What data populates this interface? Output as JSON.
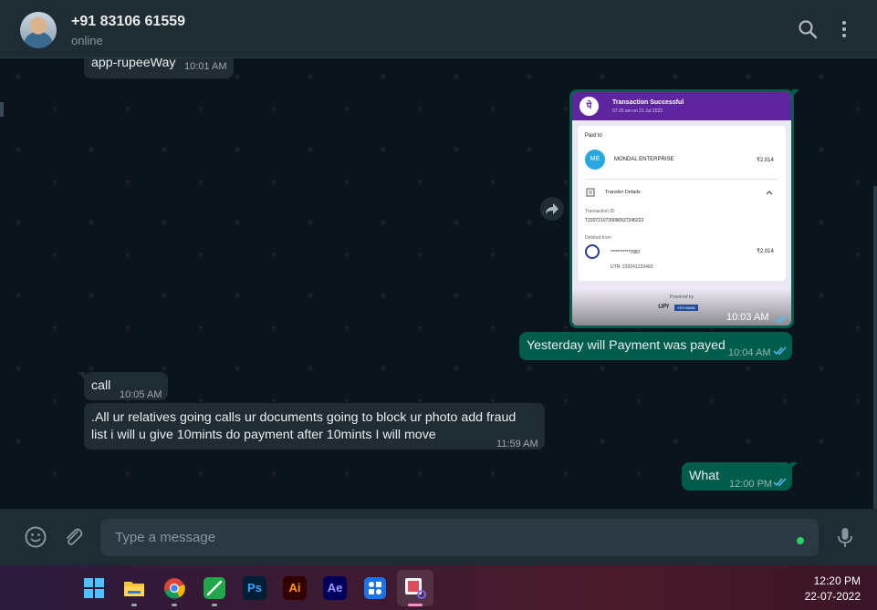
{
  "header": {
    "contact_name": "+91 83106 61559",
    "status": "online",
    "icons": [
      "search-icon",
      "more-vertical-icon"
    ]
  },
  "messages": {
    "m1": {
      "text": "app-rupeeWay",
      "time": "10:01 AM",
      "direction": "incoming"
    },
    "m2": {
      "time": "10:03 AM",
      "direction": "outgoing",
      "type": "image"
    },
    "m3": {
      "text": "Yesterday will Payment was payed",
      "time": "10:04 AM",
      "direction": "outgoing"
    },
    "m4": {
      "text": "call",
      "time": "10:05 AM",
      "direction": "incoming"
    },
    "m5": {
      "line1": ".All ur relatives going calls ur documents going to block ur photo add fraud",
      "line2": "list i will u give 10mints do payment after 10mints I will move",
      "time": "11:59 AM",
      "direction": "incoming"
    },
    "m6": {
      "text": "What",
      "time": "12:00 PM",
      "direction": "outgoing"
    }
  },
  "receipt": {
    "logo": "पे",
    "title": "Transaction Successful",
    "subtitle": "07:20 am on 21 Jul 2022",
    "paid_to_label": "Paid to",
    "payee_initials": "ME",
    "payee_name": "MONDAL ENTERPRISE",
    "payee_amount": "₹2,014",
    "transfer_details_label": "Transfer Details",
    "transaction_id_label": "Transaction ID",
    "transaction_id": "T2207210720090527245222",
    "debited_from_label": "Debited from",
    "account_masked": "***********7987",
    "debit_amount": "₹2,014",
    "utr": "UTR: 220241223493",
    "powered_by": "Powered by",
    "upi_label": "UPI",
    "bank_label": "YES BANK"
  },
  "composer": {
    "placeholder": "Type a message",
    "icons": [
      "emoji-icon",
      "attach-icon",
      "mic-icon"
    ]
  },
  "taskbar": {
    "apps": [
      {
        "name": "windows-start",
        "glyph": ""
      },
      {
        "name": "file-explorer",
        "glyph": ""
      },
      {
        "name": "chrome",
        "glyph": ""
      },
      {
        "name": "pen-app",
        "glyph": ""
      },
      {
        "name": "photoshop",
        "glyph": "Ps"
      },
      {
        "name": "illustrator",
        "glyph": "Ai"
      },
      {
        "name": "after-effects",
        "glyph": "Ae"
      },
      {
        "name": "app-widget",
        "glyph": ""
      },
      {
        "name": "snipping-tool",
        "glyph": ""
      }
    ],
    "time": "12:20 PM",
    "date": "22-07-2022"
  },
  "colors": {
    "outgoing": "#005c4b",
    "incoming": "#202c33",
    "header": "#202c33",
    "background": "#0b141a",
    "ticks": "#53bdeb",
    "upi_purple": "#5f259f"
  }
}
